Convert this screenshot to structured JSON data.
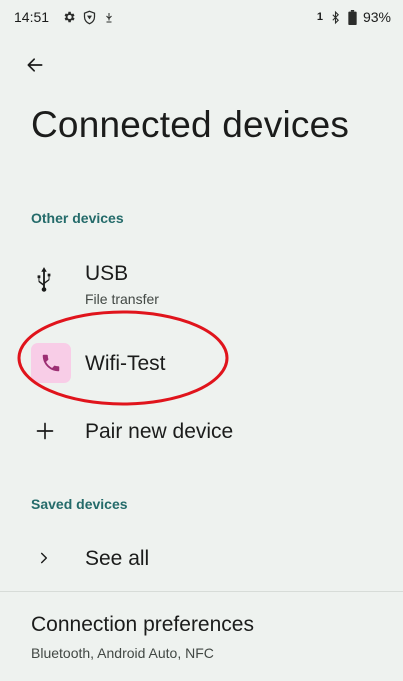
{
  "status_bar": {
    "time": "14:51",
    "sim_indicator": "1",
    "battery": "93%",
    "left_icons": [
      "gear-icon",
      "vpn-shield-icon",
      "usb-debug-icon"
    ],
    "right_icons": [
      "bluetooth-icon",
      "battery-icon"
    ]
  },
  "header": {
    "back_icon": "arrow-back-icon",
    "title": "Connected devices"
  },
  "other_devices": {
    "header": "Other devices",
    "items": [
      {
        "title": "USB",
        "subtitle": "File transfer",
        "icon": "usb-icon"
      },
      {
        "title": "Wifi-Test",
        "icon": "phone-icon"
      },
      {
        "title": "Pair new device",
        "icon": "plus-icon"
      }
    ]
  },
  "saved_devices": {
    "header": "Saved devices",
    "see_all": {
      "title": "See all",
      "icon": "chevron-right-icon"
    }
  },
  "connection_preferences": {
    "title": "Connection preferences",
    "subtitle": "Bluetooth, Android Auto, NFC"
  },
  "annotation": {
    "color": "#e0141c"
  },
  "colors": {
    "background": "#eef2ef",
    "accent": "#246b6a",
    "phone_icon": "#9c2f73",
    "phone_icon_bg": "#f8cde7"
  }
}
